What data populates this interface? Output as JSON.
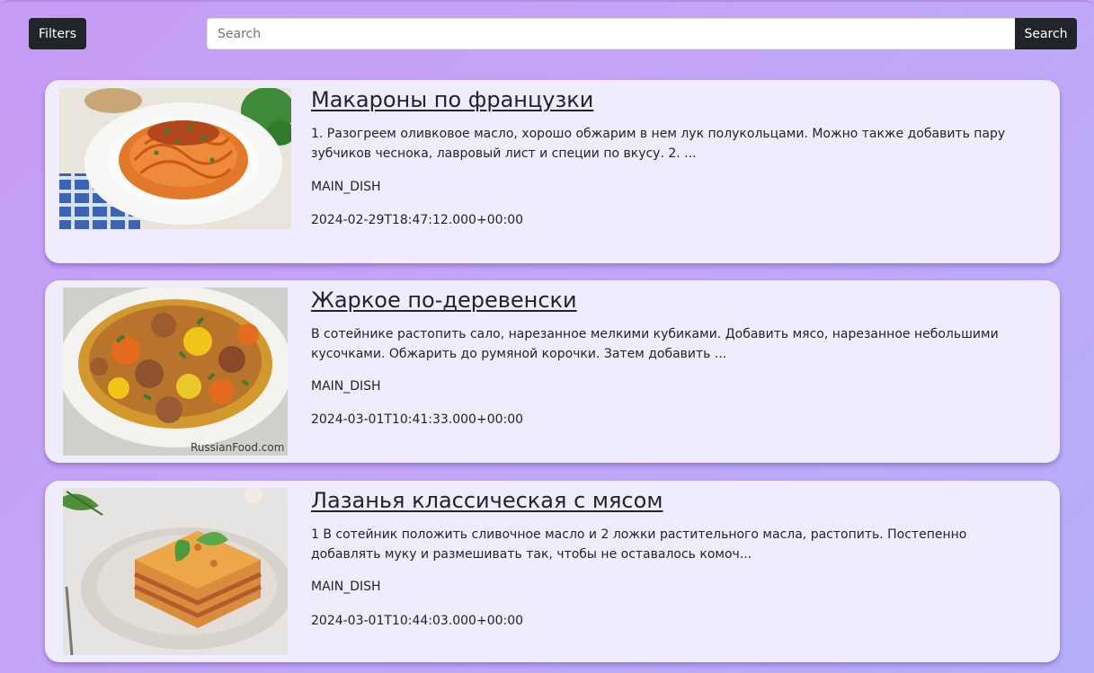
{
  "toolbar": {
    "filters_label": "Filters",
    "search_placeholder": "Search",
    "search_value": "",
    "search_label": "Search"
  },
  "recipes": [
    {
      "title": "Макароны по французки",
      "description": "1. Разогреем оливковое масло, хорошо обжарим в нем лук полукольцами. Можно также добавить пару зубчиков чеснока, лавровый лист и специи по вкусу. 2. ...",
      "category": "MAIN_DISH",
      "created": "2024-02-29T18:47:12.000+00:00",
      "image": "spaghetti-bolognese-photo"
    },
    {
      "title": "Жаркое по-деревенски",
      "description": "В сотейнике растопить сало, нарезанное мелкими кубиками. Добавить мясо, нарезанное небольшими кусочками. Обжарить до румяной корочки. Затем добавить ...",
      "category": "MAIN_DISH",
      "created": "2024-03-01T10:41:33.000+00:00",
      "image": "meat-stew-photo",
      "watermark": "RussianFood.com"
    },
    {
      "title": "Лазанья классическая с мясом",
      "description": "1 В сотейник положить сливочное масло и 2 ложки растительного масла, растопить. Постепенно добавлять муку и размешивать так, чтобы не оставалось комоч...",
      "category": "MAIN_DISH",
      "created": "2024-03-01T10:44:03.000+00:00",
      "image": "lasagna-photo"
    }
  ]
}
